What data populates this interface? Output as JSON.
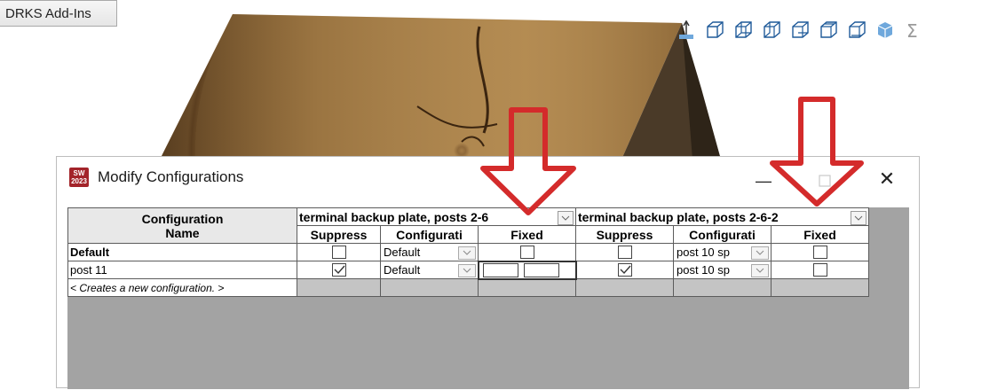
{
  "tab": {
    "label": "DRKS Add-Ins"
  },
  "toolbar": {
    "icons": [
      "normal-to-icon",
      "front-view-icon",
      "back-view-icon",
      "left-view-icon",
      "right-view-icon",
      "top-view-icon",
      "bottom-view-icon",
      "isometric-icon",
      "sum-icon"
    ]
  },
  "dialog": {
    "title": "Modify Configurations",
    "minimize": "—",
    "close": "✕",
    "icon_text": "SW 2023"
  },
  "table": {
    "name_header_line1": "Configuration",
    "name_header_line2": "Name",
    "groups": [
      {
        "label": "terminal backup plate, posts 2-6"
      },
      {
        "label": "terminal backup plate, posts 2-6-2"
      }
    ],
    "subheaders": [
      "Suppress",
      "Configurati",
      "Fixed",
      "Suppress",
      "Configurati",
      "Fixed"
    ],
    "rows": [
      {
        "name": "Default",
        "bold": true,
        "g1_suppress": false,
        "g1_config": "Default",
        "g1_fixed": false,
        "g2_suppress": false,
        "g2_config": "post 10 sp",
        "g2_fixed": false
      },
      {
        "name": "post 11",
        "bold": false,
        "g1_suppress": true,
        "g1_config": "Default",
        "g1_fixed": "editing",
        "g2_suppress": true,
        "g2_config": "post 10 sp",
        "g2_fixed": false
      }
    ],
    "new_row": "< Creates a new configuration. >"
  },
  "colors": {
    "arrow_red": "#d42b2b",
    "grid_bg": "#a3a3a3",
    "header_bg": "#e8e8e8",
    "new_row_bg": "#c4c4c4"
  }
}
